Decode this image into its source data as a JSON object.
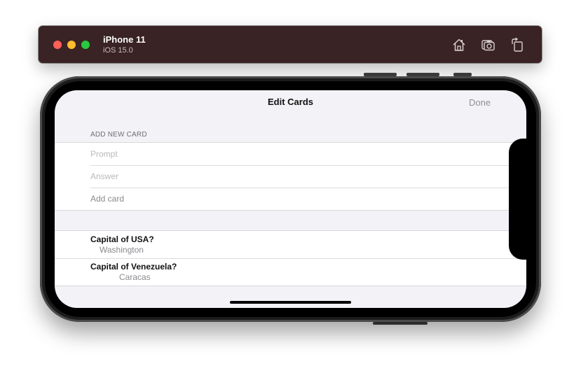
{
  "simulator": {
    "device_name": "iPhone 11",
    "os_version": "iOS 15.0",
    "buttons": [
      "home-icon",
      "screenshot-icon",
      "rotate-icon"
    ]
  },
  "nav": {
    "title": "Edit Cards",
    "done_label": "Done"
  },
  "add_section": {
    "header": "ADD NEW CARD",
    "prompt_placeholder": "Prompt",
    "answer_placeholder": "Answer",
    "add_label": "Add card"
  },
  "cards": [
    {
      "prompt": "Capital of USA?",
      "answer": "Washington"
    },
    {
      "prompt": "Capital of Venezuela?",
      "answer": "Caracas"
    }
  ],
  "colors": {
    "title_bar": "#3a2324",
    "screen_background": "#f2f2f7",
    "secondary_text": "#8a8a8e"
  }
}
